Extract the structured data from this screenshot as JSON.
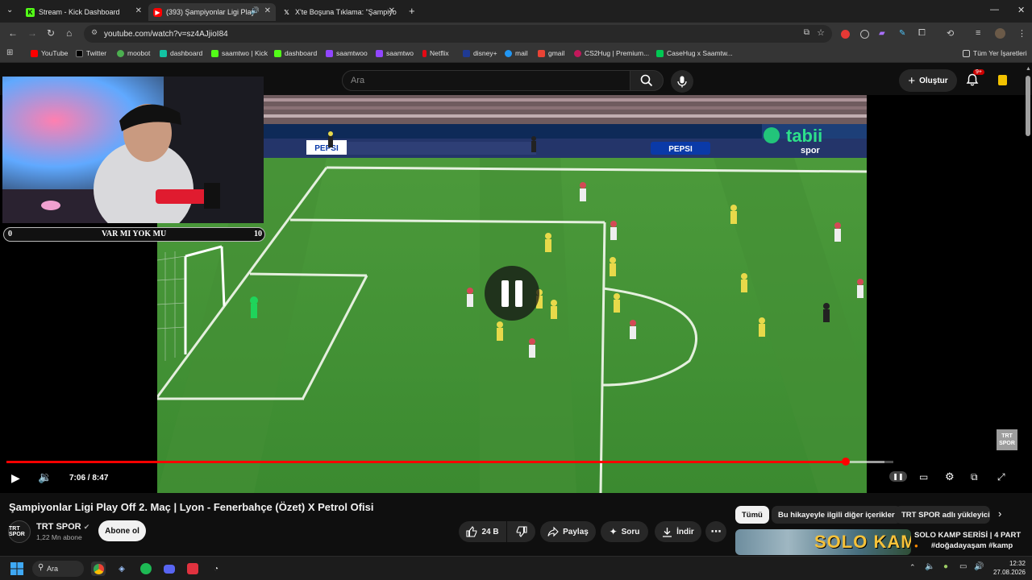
{
  "browser": {
    "tabs": [
      {
        "title": "Stream - Kick Dashboard",
        "icon": "kick-icon"
      },
      {
        "title": "(393) Şampiyonlar Ligi Play",
        "icon": "youtube-icon"
      },
      {
        "title": "X'te Boşuna Tıklama: \"Şampiyo",
        "icon": "x-icon"
      }
    ],
    "url": "youtube.com/watch?v=sz4AJjioI84",
    "bookmarks": [
      {
        "label": "YouTube",
        "color": "#ff0000"
      },
      {
        "label": "Twitter",
        "color": "#000000"
      },
      {
        "label": "moobot",
        "color": "#4caf50"
      },
      {
        "label": "dashboard",
        "color": "#13c3a3"
      },
      {
        "label": "saamtwo | Kick",
        "color": "#53fc18"
      },
      {
        "label": "dashboard",
        "color": "#53fc18"
      },
      {
        "label": "saamtwoo",
        "color": "#9146ff"
      },
      {
        "label": "saamtwo",
        "color": "#9146ff"
      },
      {
        "label": "Netflix",
        "color": "#e50914"
      },
      {
        "label": "disney+",
        "color": "#1f3a93"
      },
      {
        "label": "mail",
        "color": "#2196f3"
      },
      {
        "label": "gmail",
        "color": "#ea4335"
      },
      {
        "label": "CS2Hug | Premium...",
        "color": "#c2185b"
      },
      {
        "label": "CaseHug x Saamtw...",
        "color": "#00c853"
      }
    ],
    "all_bookmarks": "Tüm Yer İşaretleri"
  },
  "youtube": {
    "search_placeholder": "Ara",
    "create_label": "Oluştur",
    "notifications_badge": "9+"
  },
  "overlay": {
    "score_left": "0",
    "score_label": "VAR MI YOK MU",
    "score_right": "10"
  },
  "video": {
    "broadcaster_logo": "tabii",
    "broadcaster_sub": "spor",
    "watermark": "TRT SPOR",
    "current_time": "7:06",
    "duration": "8:47",
    "progress": 0.9466,
    "buffered": 0.99,
    "state": "paused"
  },
  "meta": {
    "title": "Şampiyonlar Ligi Play Off 2. Maç | Lyon - Fenerbahçe (Özet) X Petrol Ofisi",
    "channel_name": "TRT SPOR",
    "subscribers": "1,22 Mn abone",
    "subscribe_label": "Abone ol",
    "likes": "24 B",
    "share_label": "Paylaş",
    "ask_label": "Soru",
    "download_label": "İndir"
  },
  "recommendations": {
    "chips": [
      "Tümü",
      "Bu hikayeyle ilgili diğer içerikler",
      "TRT SPOR adlı yükleyici"
    ],
    "first_title_line1": "SOLO KAMP SERİSİ | 4 PART",
    "first_title_line2": "#doğadayaşam #kamp",
    "thumb_text": "SOLO KAMP"
  },
  "taskbar": {
    "search_label": "Ara",
    "time": "12:32",
    "date": "27.08.2026"
  },
  "colors": {
    "accent_red": "#ff0000",
    "pitch_green": "#3f8f3a",
    "kick_green": "#53fc18"
  }
}
